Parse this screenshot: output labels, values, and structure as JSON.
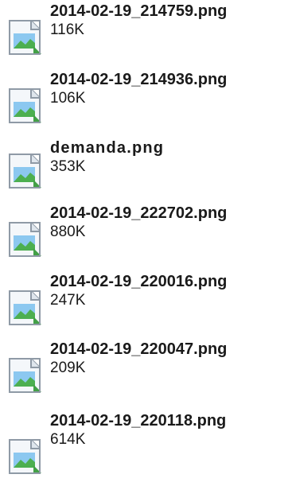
{
  "files": [
    {
      "name": "2014-02-19_214759.png",
      "size": "116K",
      "icon": "image-file-icon"
    },
    {
      "name": "2014-02-19_214936.png",
      "size": "106K",
      "icon": "image-file-icon"
    },
    {
      "name": "demanda.png",
      "size": "353K",
      "icon": "image-file-icon"
    },
    {
      "name": "2014-02-19_222702.png",
      "size": "880K",
      "icon": "image-file-icon"
    },
    {
      "name": "2014-02-19_220016.png",
      "size": "247K",
      "icon": "image-file-icon"
    },
    {
      "name": "2014-02-19_220047.png",
      "size": "209K",
      "icon": "image-file-icon"
    },
    {
      "name": "2014-02-19_220118.png",
      "size": "614K",
      "icon": "image-file-icon"
    }
  ],
  "colors": {
    "text": "#1a1a1a",
    "icon_border": "#8f9aa6",
    "icon_fill": "#eef3f8",
    "icon_green": "#4caf50",
    "icon_blue": "#8cc8f0"
  }
}
